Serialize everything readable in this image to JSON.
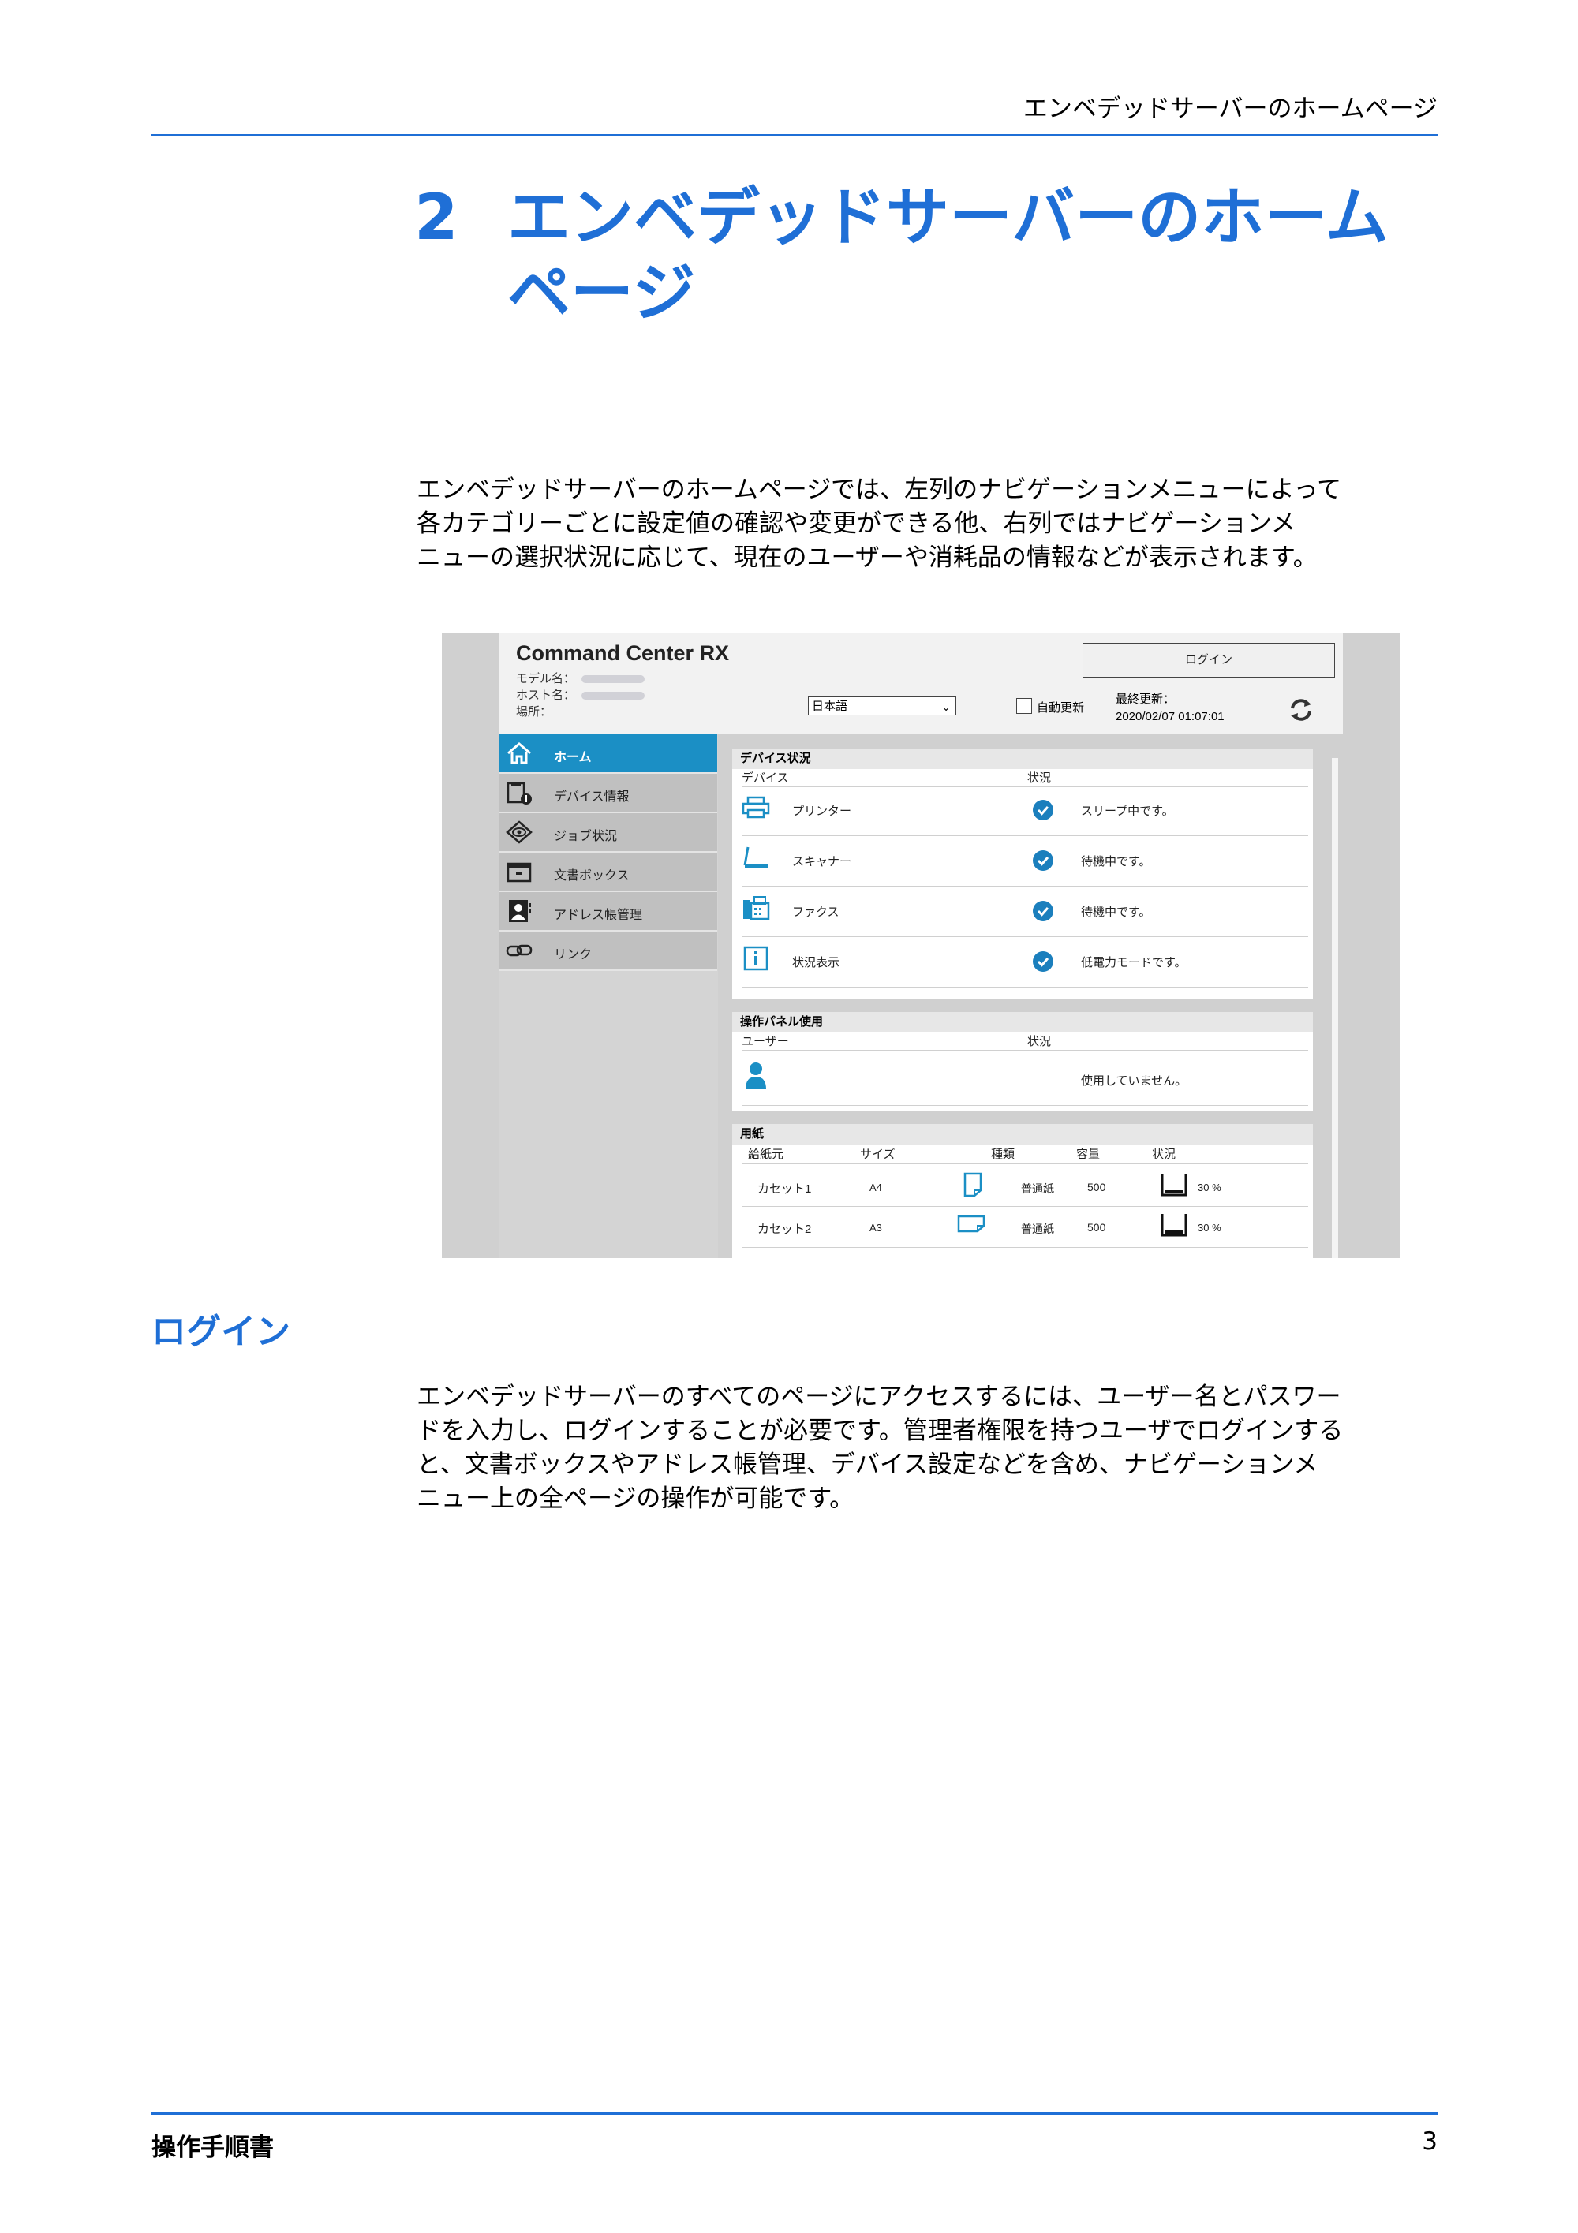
{
  "header": {
    "running_title": "エンベデッドサーバーのホームページ"
  },
  "chapter": {
    "number": "2",
    "title_line1": "エンベデッドサーバーのホーム",
    "title_line2": "ページ"
  },
  "intro": {
    "lines": [
      "エンベデッドサーバーのホームページでは、左列のナビゲーションメニューによって",
      "各カテゴリーごとに設定値の確認や変更ができる他、右列ではナビゲーションメ",
      "ニューの選択状況に応じて、現在のユーザーや消耗品の情報などが表示されます。"
    ]
  },
  "screenshot": {
    "brand": "Command Center RX",
    "model_label": "モデル名：",
    "host_label": "ホスト名：",
    "location_label": "場所：",
    "login_button": "ログイン",
    "language": "日本語",
    "auto_refresh": "自動更新",
    "last_update_label": "最終更新：",
    "last_update_value": "2020/02/07 01:07:01",
    "nav": [
      {
        "label": "ホーム",
        "icon": "home-icon"
      },
      {
        "label": "デバイス情報",
        "icon": "device-info-icon"
      },
      {
        "label": "ジョブ状況",
        "icon": "job-status-icon"
      },
      {
        "label": "文書ボックス",
        "icon": "document-box-icon"
      },
      {
        "label": "アドレス帳管理",
        "icon": "address-book-icon"
      },
      {
        "label": "リンク",
        "icon": "link-icon"
      }
    ],
    "device_status": {
      "title": "デバイス状況",
      "col_device": "デバイス",
      "col_status": "状況",
      "rows": [
        {
          "name": "プリンター",
          "status": "スリープ中です。",
          "icon": "printer-icon"
        },
        {
          "name": "スキャナー",
          "status": "待機中です。",
          "icon": "scanner-icon"
        },
        {
          "name": "ファクス",
          "status": "待機中です。",
          "icon": "fax-icon"
        },
        {
          "name": "状況表示",
          "status": "低電力モードです。",
          "icon": "info-icon"
        }
      ]
    },
    "panel_usage": {
      "title": "操作パネル使用",
      "col_user": "ユーザー",
      "col_status": "状況",
      "status": "使用していません。"
    },
    "paper": {
      "title": "用紙",
      "cols": [
        "給紙元",
        "サイズ",
        "種類",
        "容量",
        "状況"
      ],
      "rows": [
        {
          "source": "カセット1",
          "size": "A4",
          "type": "普通紙",
          "capacity": "500",
          "level": "30 %"
        },
        {
          "source": "カセット2",
          "size": "A3",
          "type": "普通紙",
          "capacity": "500",
          "level": "30 %"
        }
      ]
    },
    "colors": {
      "accent": "#1b8fc5",
      "check": "#1b7fbd"
    }
  },
  "login_section": {
    "heading": "ログイン",
    "lines": [
      "エンベデッドサーバーのすべてのページにアクセスするには、ユーザー名とパスワー",
      "ドを入力し、ログインすることが必要です。管理者権限を持つユーザでログインする",
      "と、文書ボックスやアドレス帳管理、デバイス設定などを含め、ナビゲーションメ",
      "ニュー上の全ページの操作が可能です。"
    ]
  },
  "footer": {
    "left": "操作手順書",
    "page": "3"
  }
}
